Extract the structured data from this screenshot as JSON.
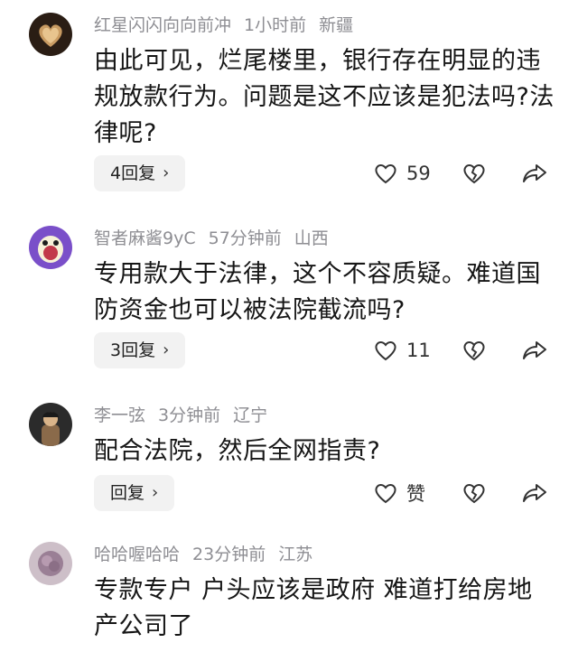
{
  "comments": [
    {
      "username": "红星闪闪向向前冲",
      "time": "1小时前",
      "location": "新疆",
      "text": "由此可见，烂尾楼里，银行存在明显的违规放款行为。问题是这不应该是犯法吗?法律呢?",
      "reply_label": "4回复",
      "like_count": "59"
    },
    {
      "username": "智者麻酱9yC",
      "time": "57分钟前",
      "location": "山西",
      "text": "专用款大于法律，这个不容质疑。难道国防资金也可以被法院截流吗?",
      "reply_label": "3回复",
      "like_count": "11"
    },
    {
      "username": "李一弦",
      "time": "3分钟前",
      "location": "辽宁",
      "text": "配合法院，然后全网指责?",
      "reply_label": "回复",
      "like_count": "赞"
    },
    {
      "username": "哈哈喔哈哈",
      "time": "23分钟前",
      "location": "江苏",
      "text": "专款专户 户头应该是政府 难道打给房地产公司了"
    }
  ],
  "icons": {
    "like": "heart-outline-icon",
    "dislike": "broken-heart-icon",
    "share": "share-arrow-icon",
    "chevron": "chevron-right-icon"
  }
}
